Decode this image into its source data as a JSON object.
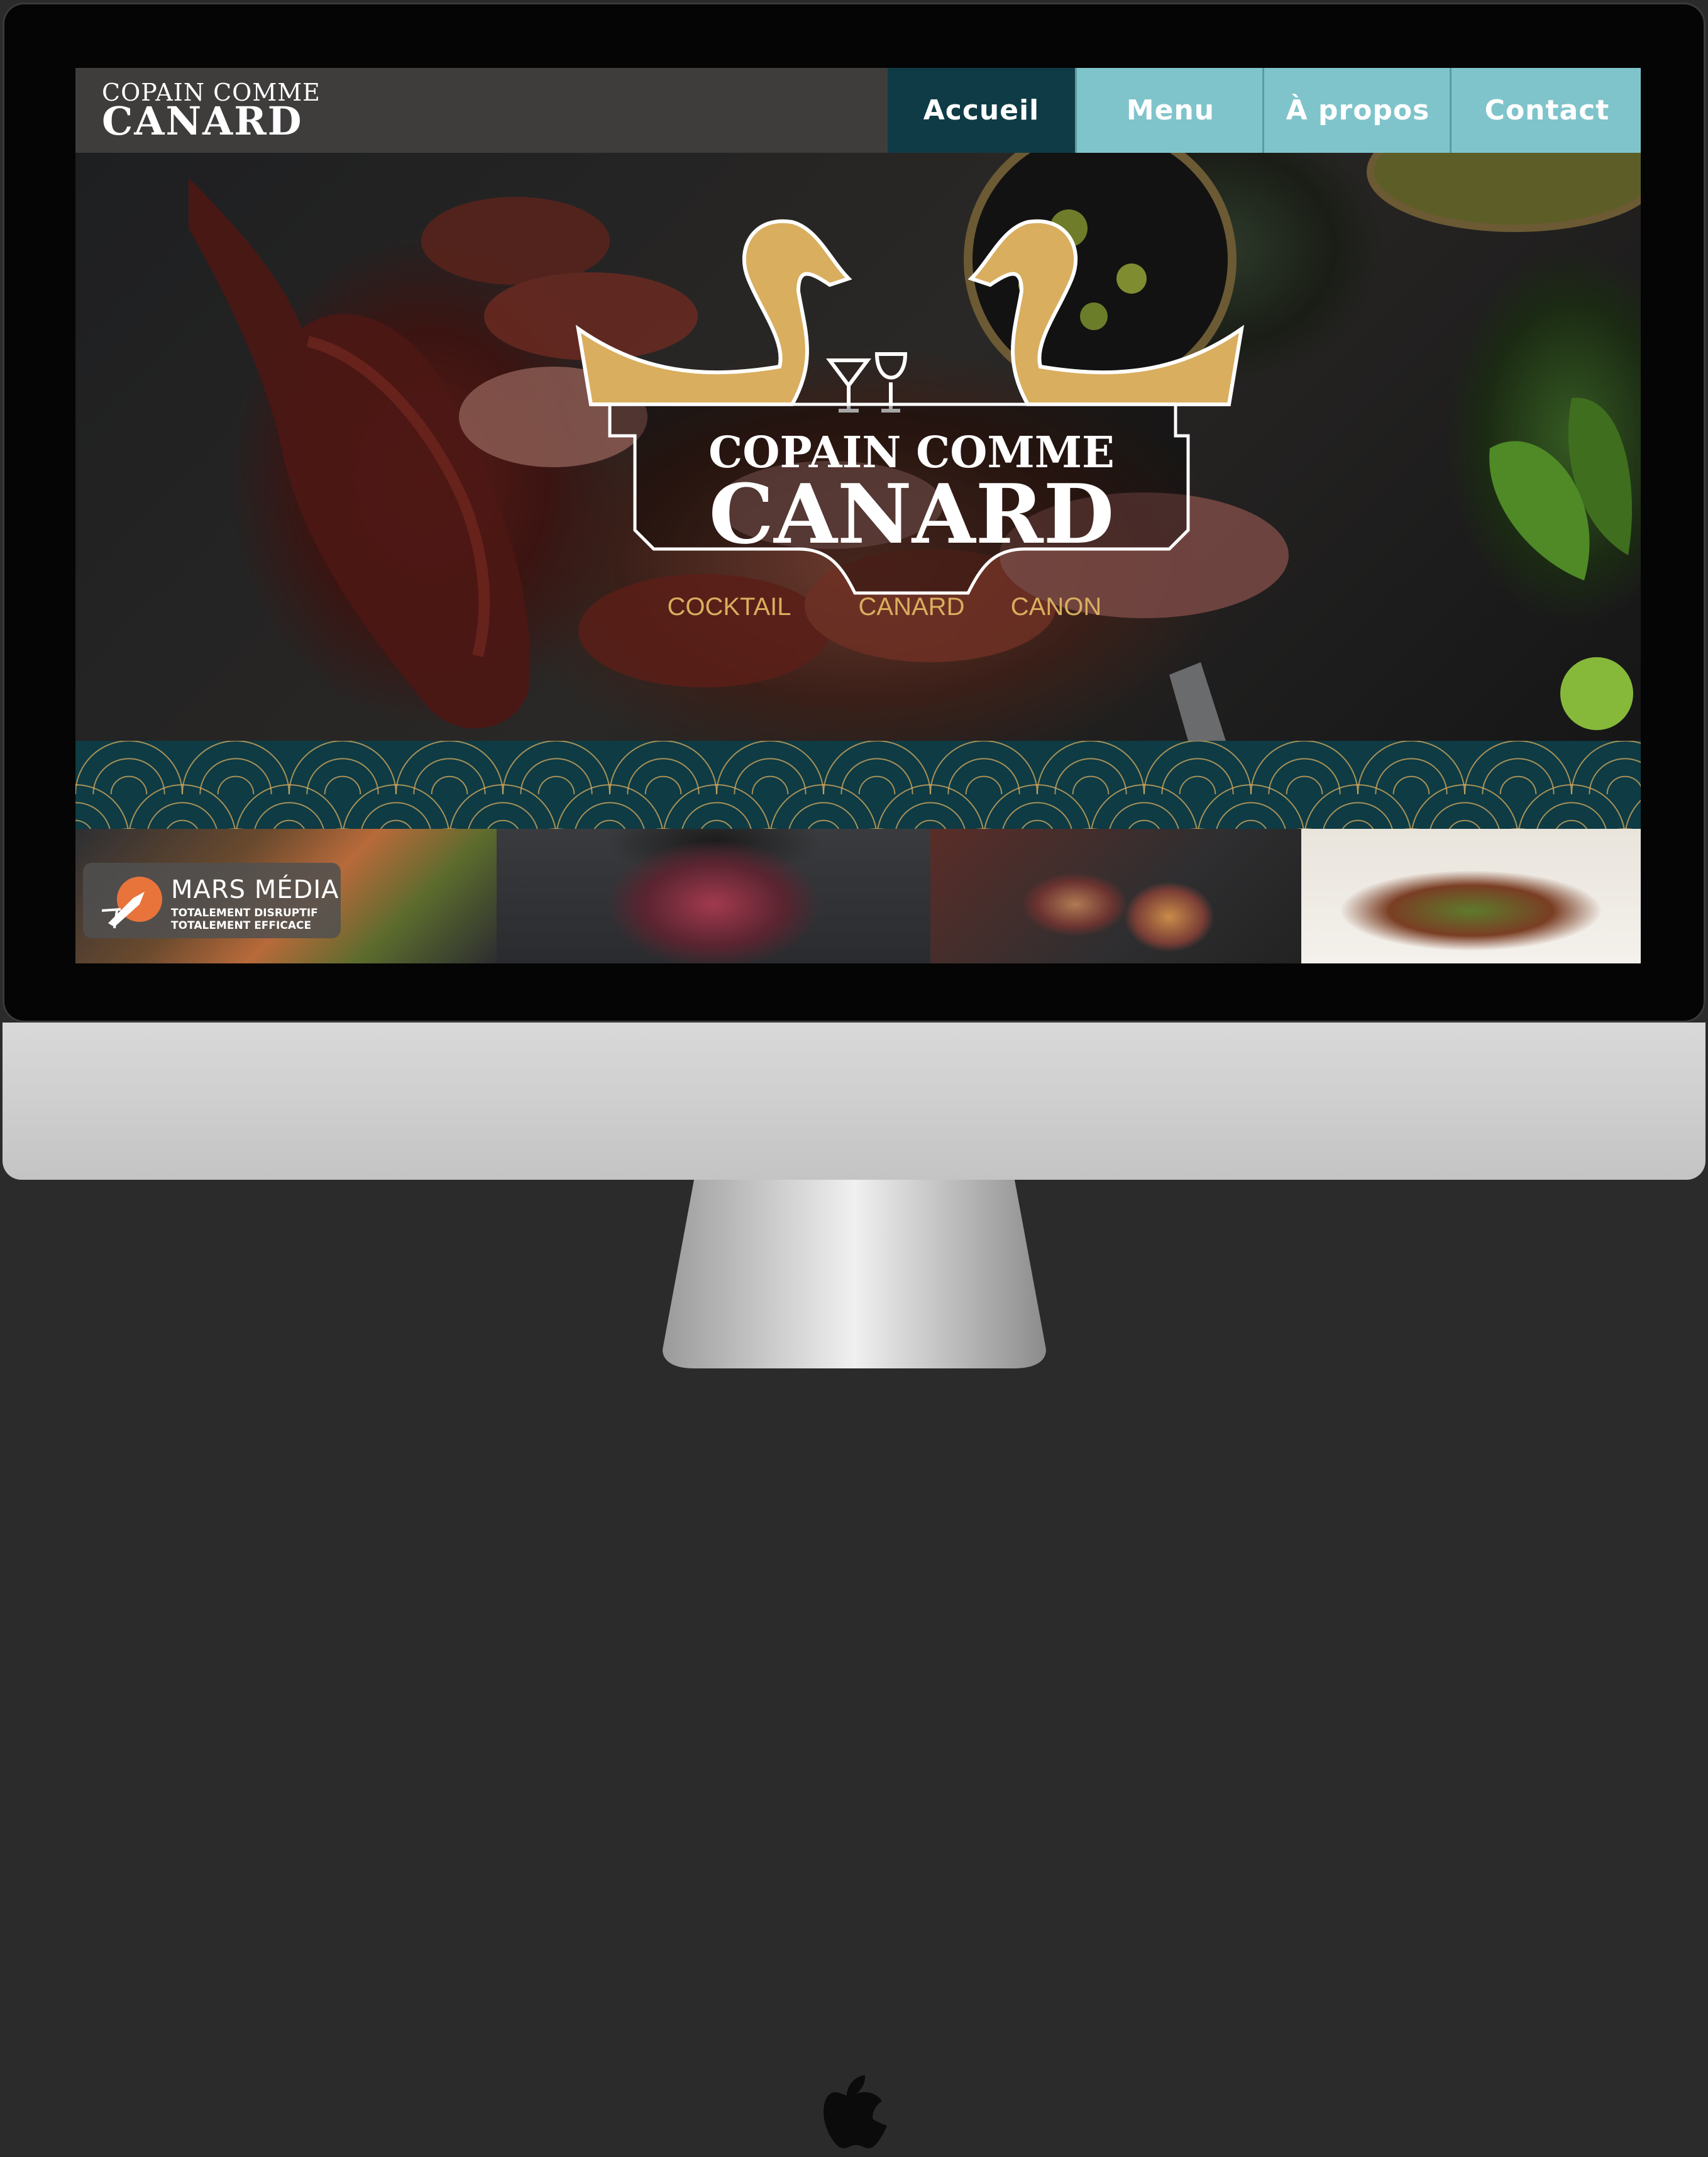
{
  "nav": {
    "brand_line1": "COPAIN COMME",
    "brand_line2": "CANARD",
    "items": [
      {
        "label": "Accueil",
        "active": true
      },
      {
        "label": "Menu",
        "active": false
      },
      {
        "label": "À propos",
        "active": false
      },
      {
        "label": "Contact",
        "active": false
      }
    ]
  },
  "hero": {
    "logo_line1": "COPAIN COMME",
    "logo_line2": "CANARD",
    "tagline": [
      "COCKTAIL",
      "CANARD",
      "CANON"
    ]
  },
  "badge": {
    "name": "MARS MÉDIA",
    "line1": "TOTALEMENT DISRUPTIF",
    "line2": "TOTALEMENT EFFICACE"
  },
  "colors": {
    "nav_active": "#0f3b46",
    "nav_inactive": "#7fc4cb",
    "pattern_bg": "#0e3b44",
    "gold": "#d9ae5f"
  },
  "icons": [
    "apple-logo-icon",
    "rocket-icon",
    "duck-icon",
    "cocktail-glass-icon",
    "wine-glass-icon"
  ]
}
